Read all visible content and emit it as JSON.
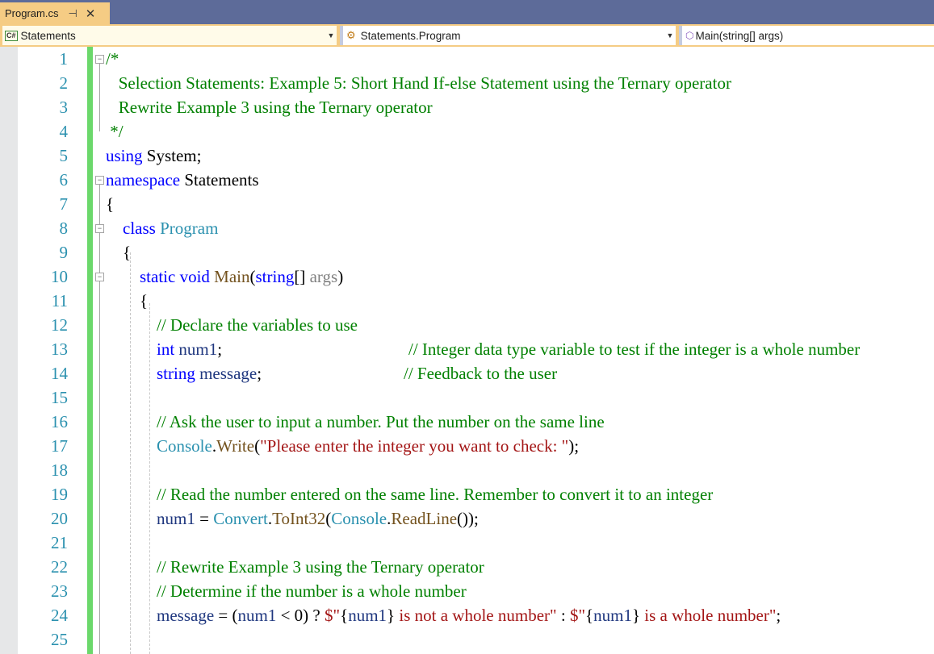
{
  "tab": {
    "title": "Program.cs",
    "pin_icon": "pin-icon",
    "close_icon": "close-icon"
  },
  "navbar": {
    "project": {
      "badge": "C#",
      "label": "Statements"
    },
    "type": {
      "label": "Statements.Program",
      "icon": "class-icon"
    },
    "member": {
      "label": "Main(string[] args)",
      "icon": "method-private-icon"
    }
  },
  "line_numbers": [
    "1",
    "2",
    "3",
    "4",
    "5",
    "6",
    "7",
    "8",
    "9",
    "10",
    "11",
    "12",
    "13",
    "14",
    "15",
    "16",
    "17",
    "18",
    "19",
    "20",
    "21",
    "22",
    "23",
    "24",
    "25"
  ],
  "code": {
    "l1": "/*",
    "l2": "   Selection Statements: Example 5: Short Hand If-else Statement using the Ternary operator",
    "l3": "   Rewrite Example 3 using the Ternary operator",
    "l4": " */",
    "l5_kw": "using",
    "l5_rest": " System;",
    "l6_kw": "namespace",
    "l6_rest": " Statements",
    "l7": "{",
    "l8_kw": "class",
    "l8_type": "Program",
    "l9": "{",
    "l10_kw1": "static",
    "l10_kw2": "void",
    "l10_method": "Main",
    "l10_kw3": "string",
    "l10_param": "args",
    "l11": "{",
    "l12": "// Declare the variables to use",
    "l13_kw": "int",
    "l13_var": "num1",
    "l13_comment": "// Integer data type variable to test if the integer is a whole number",
    "l14_kw": "string",
    "l14_var": "message",
    "l14_comment": "// Feedback to the user",
    "l16": "// Ask the user to input a number. Put the number on the same line",
    "l17_type": "Console",
    "l17_method": "Write",
    "l17_string": "\"Please enter the integer you want to check: \"",
    "l19": "// Read the number entered on the same line. Remember to convert it to an integer",
    "l20_var": "num1",
    "l20_type1": "Convert",
    "l20_method1": "ToInt32",
    "l20_type2": "Console",
    "l20_method2": "ReadLine",
    "l22": "// Rewrite Example 3 using the Ternary operator",
    "l23": "// Determine if the number is a whole number",
    "l24_var1": "message",
    "l24_var2": "num1",
    "l24_s1": "$\"",
    "l24_var3": "num1",
    "l24_s2": " is not a whole number\"",
    "l24_s3": "$\"",
    "l24_var4": "num1",
    "l24_s4": " is a whole number\""
  }
}
